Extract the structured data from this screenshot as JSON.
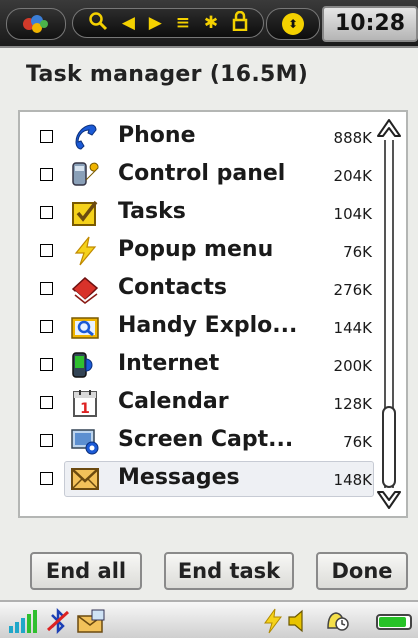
{
  "status_bar": {
    "time": "10:28"
  },
  "title": "Task manager (16.5M)",
  "tasks": [
    {
      "name": "Phone",
      "size": "888K",
      "icon": "phone-icon"
    },
    {
      "name": "Control panel",
      "size": "204K",
      "icon": "control-panel-icon"
    },
    {
      "name": "Tasks",
      "size": "104K",
      "icon": "tasks-icon"
    },
    {
      "name": "Popup menu",
      "size": "76K",
      "icon": "lightning-icon"
    },
    {
      "name": "Contacts",
      "size": "276K",
      "icon": "contacts-book-icon"
    },
    {
      "name": "Handy Explo...",
      "size": "144K",
      "icon": "explorer-icon"
    },
    {
      "name": "Internet",
      "size": "200K",
      "icon": "internet-icon"
    },
    {
      "name": "Calendar",
      "size": "128K",
      "icon": "calendar-icon"
    },
    {
      "name": "Screen Capt...",
      "size": "76K",
      "icon": "screen-capture-icon"
    },
    {
      "name": "Messages",
      "size": "148K",
      "icon": "envelope-icon"
    }
  ],
  "selected_index": 9,
  "buttons": {
    "end_all": "End all",
    "end_task": "End task",
    "done": "Done"
  },
  "battery_level": 0.9,
  "colors": {
    "accent_yellow": "#f4d100",
    "battery_green": "#27c227"
  }
}
